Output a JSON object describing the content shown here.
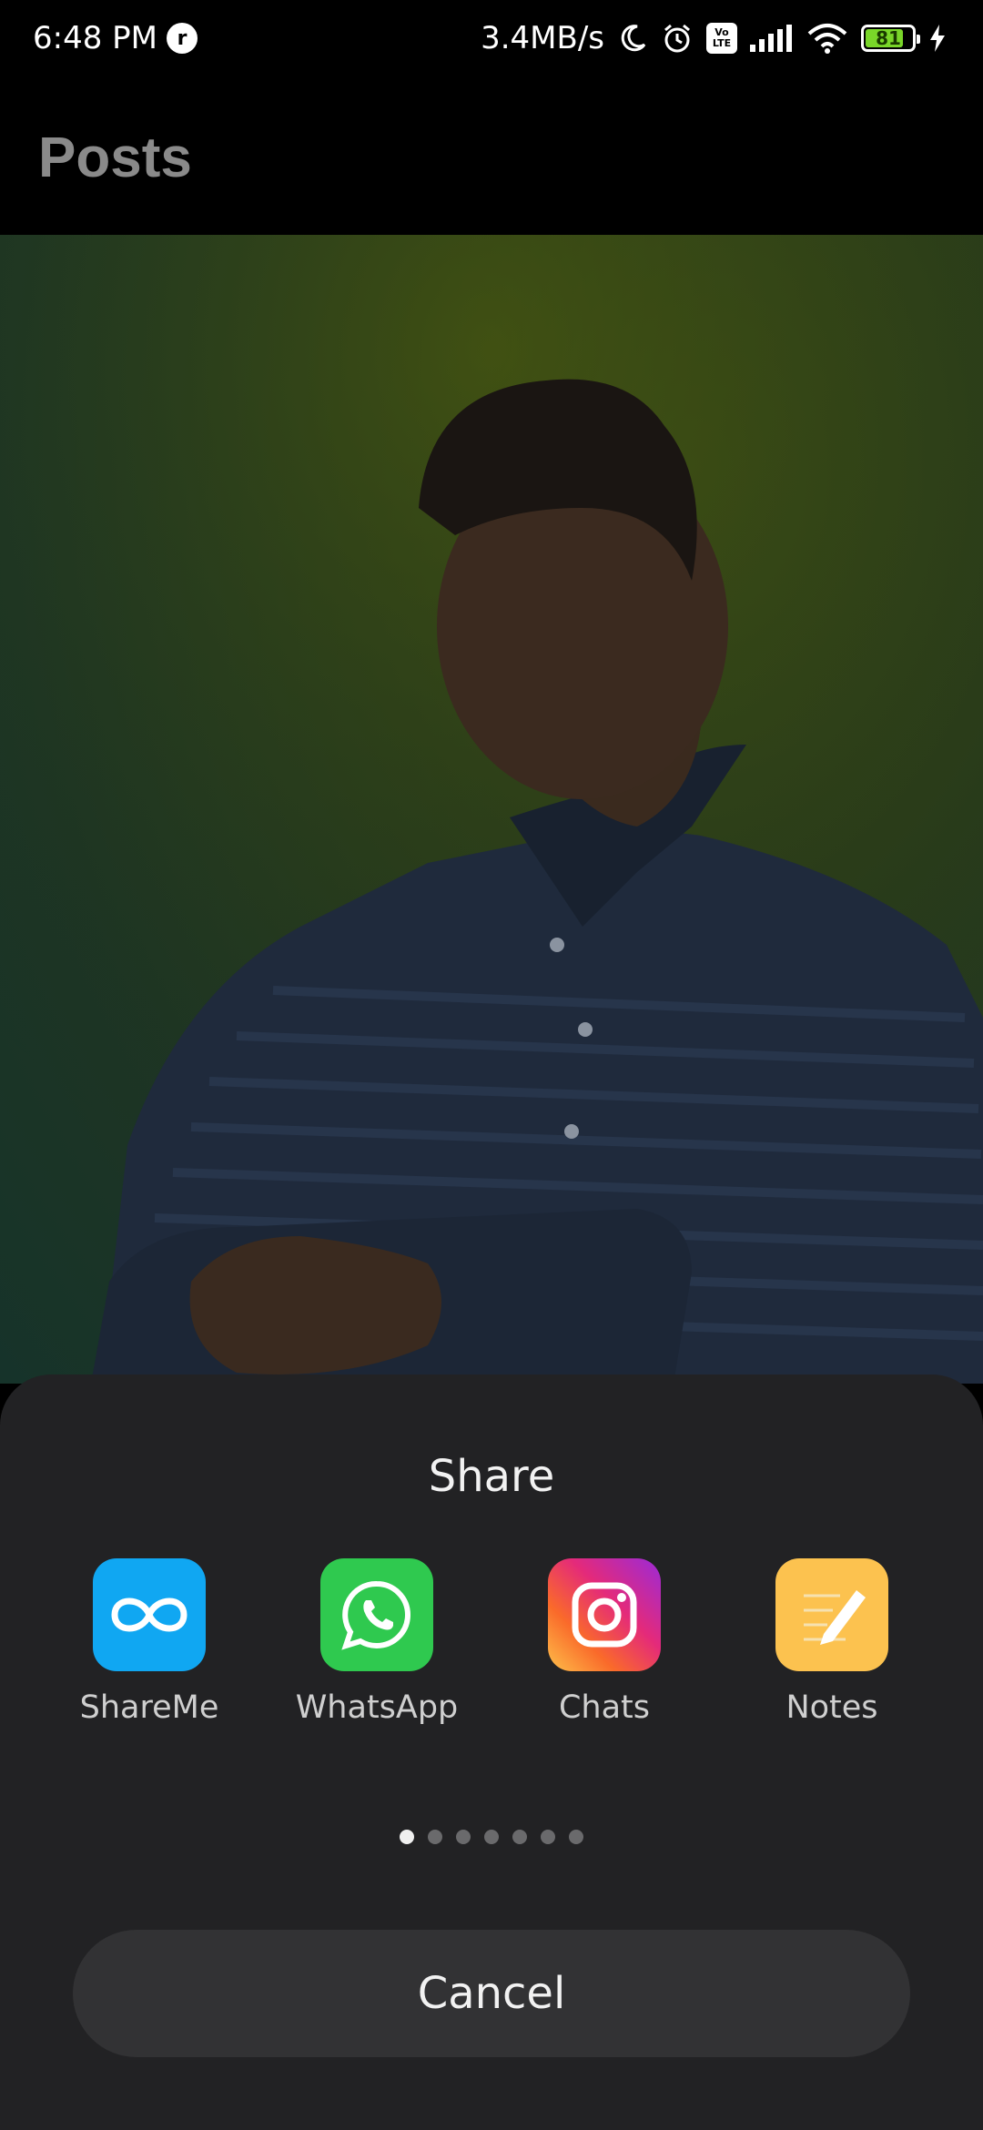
{
  "status_bar": {
    "time": "6:48 PM",
    "notification_badge": "r",
    "network_speed": "3.4MB/s",
    "volte_top": "Vo",
    "volte_bottom": "LTE",
    "battery_level": "81",
    "battery_fraction": 0.81,
    "icons": [
      "moon-icon",
      "alarm-icon",
      "volte-icon",
      "signal-icon",
      "wifi-icon",
      "battery-icon",
      "charging-icon"
    ]
  },
  "header": {
    "title": "Posts"
  },
  "share_sheet": {
    "title": "Share",
    "apps": [
      {
        "label": "ShareMe",
        "icon": "shareme-icon",
        "color": "#10a7f2"
      },
      {
        "label": "WhatsApp",
        "icon": "whatsapp-icon",
        "color": "#2fc94f"
      },
      {
        "label": "Chats",
        "icon": "instagram-icon",
        "color": "#e42a7a"
      },
      {
        "label": "Notes",
        "icon": "notes-icon",
        "color": "#fcc24f"
      }
    ],
    "page_count": 7,
    "active_page": 1,
    "cancel_label": "Cancel"
  }
}
